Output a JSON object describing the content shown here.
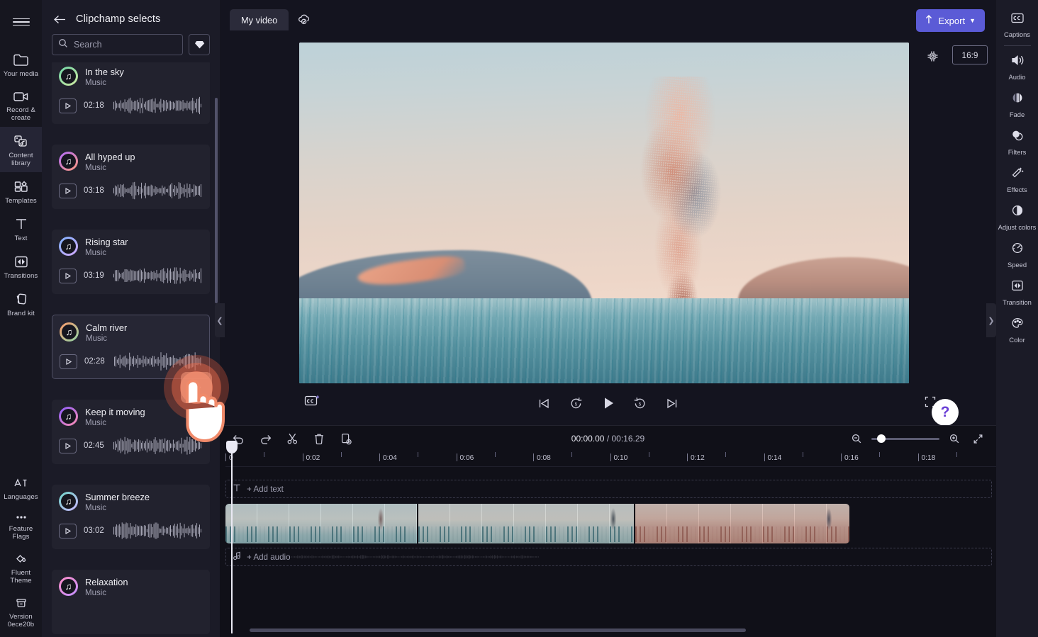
{
  "app": {
    "brand_accent": "#5b5bd6",
    "bg": "#14141f",
    "panel_bg": "#1b1b27"
  },
  "left_rail": {
    "menu_icon": "hamburger-icon",
    "items": [
      {
        "icon": "folder-icon",
        "label": "Your media",
        "active": false
      },
      {
        "icon": "video-camera-icon",
        "label": "Record & create",
        "active": false
      },
      {
        "icon": "content-library-icon",
        "label": "Content library",
        "active": true
      },
      {
        "icon": "templates-icon",
        "label": "Templates",
        "active": false
      },
      {
        "icon": "text-icon",
        "label": "Text",
        "active": false
      },
      {
        "icon": "transitions-icon",
        "label": "Transitions",
        "active": false
      },
      {
        "icon": "brand-kit-icon",
        "label": "Brand kit",
        "active": false
      }
    ],
    "bottom_items": [
      {
        "icon": "languages-icon",
        "label": "Languages"
      },
      {
        "icon": "ellipsis-icon",
        "label": "Feature Flags"
      },
      {
        "icon": "fluent-theme-icon",
        "label": "Fluent Theme"
      },
      {
        "icon": "version-icon",
        "label": "Version 0ece20b"
      }
    ]
  },
  "library": {
    "back_icon": "arrow-left-icon",
    "title": "Clipchamp selects",
    "search": {
      "icon": "search-icon",
      "placeholder": "Search",
      "value": ""
    },
    "premium_icon": "diamond-icon",
    "tracks": [
      {
        "name": "In the sky",
        "kind": "Music",
        "duration": "02:18",
        "selected": false,
        "ring": [
          "#6fd6a8",
          "#cfe8a0"
        ]
      },
      {
        "name": "All hyped up",
        "kind": "Music",
        "duration": "03:18",
        "selected": false,
        "ring": [
          "#b06bff",
          "#ff9a7a"
        ]
      },
      {
        "name": "Rising star",
        "kind": "Music",
        "duration": "03:19",
        "selected": false,
        "ring": [
          "#7fb3ff",
          "#d3a8ff"
        ]
      },
      {
        "name": "Calm river",
        "kind": "Music",
        "duration": "02:28",
        "selected": true,
        "ring": [
          "#ff9a6b",
          "#8fd6a8"
        ]
      },
      {
        "name": "Keep it moving",
        "kind": "Music",
        "duration": "02:45",
        "selected": false,
        "ring": [
          "#8a5bff",
          "#ff8fb0"
        ]
      },
      {
        "name": "Summer breeze",
        "kind": "Music",
        "duration": "03:02",
        "selected": false,
        "ring": [
          "#6fd6c8",
          "#cbb6ff"
        ]
      },
      {
        "name": "Relaxation",
        "kind": "Music",
        "duration": "",
        "selected": false,
        "ring": [
          "#ff8fc8",
          "#c08fff"
        ]
      }
    ],
    "play_icon": "play-icon",
    "collapse_left_icon": "chevron-left-icon"
  },
  "topbar": {
    "project_tab": "My video",
    "cloud_icon": "cloud-saved-icon",
    "export_label": "Export",
    "export_icon": "upload-icon",
    "export_caret": "chevron-down-icon"
  },
  "preview": {
    "gear_icon": "gear-icon",
    "aspect_ratio": "16:9",
    "collapse_right_icon": "chevron-right-icon",
    "scene_description": "Water splash plume over sea at sunset with distant hills"
  },
  "player": {
    "captions_icon": "captions-add-icon",
    "skip_start_icon": "skip-to-start-icon",
    "back5_icon": "rewind-5-icon",
    "play_icon": "play-icon",
    "forward5_icon": "forward-5-icon",
    "skip_end_icon": "skip-to-end-icon",
    "fullscreen_icon": "fullscreen-icon",
    "help_icon": "help-question-icon",
    "help_caret_icon": "chevron-down-icon"
  },
  "timeline": {
    "tools": [
      {
        "icon": "undo-icon",
        "name": "undo"
      },
      {
        "icon": "redo-icon",
        "name": "redo"
      },
      {
        "icon": "scissors-icon",
        "name": "split"
      },
      {
        "icon": "trash-icon",
        "name": "delete"
      },
      {
        "icon": "duplicate-icon",
        "name": "duplicate"
      }
    ],
    "current_time": "00:00.00",
    "separator": " / ",
    "total_time": "00:16.29",
    "zoom_out_icon": "zoom-out-icon",
    "zoom_in_icon": "zoom-in-icon",
    "fit_icon": "fit-to-screen-icon",
    "zoom_value": 10,
    "ruler_ticks": [
      "0",
      "0:02",
      "0:04",
      "0:06",
      "0:08",
      "0:10",
      "0:12",
      "0:14",
      "0:16",
      "0:18"
    ],
    "text_track": {
      "icon": "text-icon",
      "label": "+ Add text"
    },
    "audio_track": {
      "icon": "music-note-icon",
      "label": "+ Add audio"
    },
    "clips": [
      {
        "name": "clip-1"
      },
      {
        "name": "clip-2"
      },
      {
        "name": "clip-3"
      }
    ]
  },
  "right_rail": {
    "items": [
      {
        "icon": "captions-icon",
        "label": "Captions",
        "divider_after": true
      },
      {
        "icon": "audio-icon",
        "label": "Audio",
        "divider_after": false
      },
      {
        "icon": "fade-icon",
        "label": "Fade",
        "divider_after": false
      },
      {
        "icon": "filters-icon",
        "label": "Filters",
        "divider_after": false
      },
      {
        "icon": "effects-icon",
        "label": "Effects",
        "divider_after": false
      },
      {
        "icon": "adjust-colors-icon",
        "label": "Adjust colors",
        "divider_after": false
      },
      {
        "icon": "speed-icon",
        "label": "Speed",
        "divider_after": false
      },
      {
        "icon": "transition-icon",
        "label": "Transition",
        "divider_after": false
      },
      {
        "icon": "color-icon",
        "label": "Color",
        "divider_after": false
      }
    ]
  },
  "cursor_overlay": {
    "icon": "hand-pointer-icon",
    "action_icon": "plus-icon",
    "highlight_color": "#e8684a"
  }
}
